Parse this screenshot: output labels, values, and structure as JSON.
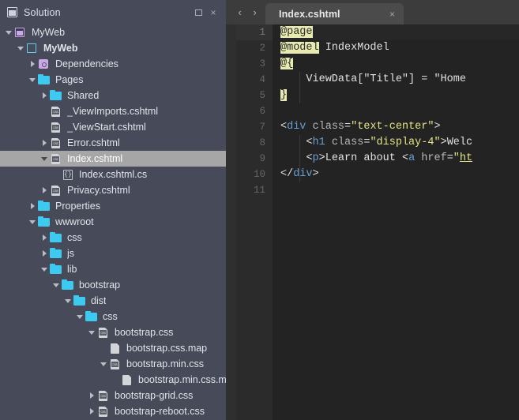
{
  "sidebar": {
    "header": {
      "title": "Solution",
      "icon": "solution-icon",
      "dock_label": "",
      "close_label": "×"
    },
    "tree": [
      {
        "label": "MyWeb",
        "depth": 0,
        "twisty": "open",
        "icon": "solution",
        "bold": false,
        "selected": false
      },
      {
        "label": "MyWeb",
        "depth": 1,
        "twisty": "open",
        "icon": "project",
        "bold": true,
        "selected": false
      },
      {
        "label": "Dependencies",
        "depth": 2,
        "twisty": "closed",
        "icon": "dep",
        "bold": false,
        "selected": false
      },
      {
        "label": "Pages",
        "depth": 2,
        "twisty": "open",
        "icon": "folder",
        "bold": false,
        "selected": false
      },
      {
        "label": "Shared",
        "depth": 3,
        "twisty": "closed",
        "icon": "folder",
        "bold": false,
        "selected": false
      },
      {
        "label": "_ViewImports.cshtml",
        "depth": 3,
        "twisty": "none",
        "icon": "cshtml",
        "bold": false,
        "selected": false
      },
      {
        "label": "_ViewStart.cshtml",
        "depth": 3,
        "twisty": "none",
        "icon": "cshtml",
        "bold": false,
        "selected": false
      },
      {
        "label": "Error.cshtml",
        "depth": 3,
        "twisty": "closed",
        "icon": "cshtml",
        "bold": false,
        "selected": false
      },
      {
        "label": "Index.cshtml",
        "depth": 3,
        "twisty": "open",
        "icon": "cshtml",
        "bold": false,
        "selected": true
      },
      {
        "label": "Index.cshtml.cs",
        "depth": 4,
        "twisty": "none",
        "icon": "cs",
        "bold": false,
        "selected": false
      },
      {
        "label": "Privacy.cshtml",
        "depth": 3,
        "twisty": "closed",
        "icon": "cshtml",
        "bold": false,
        "selected": false
      },
      {
        "label": "Properties",
        "depth": 2,
        "twisty": "closed",
        "icon": "folder",
        "bold": false,
        "selected": false
      },
      {
        "label": "wwwroot",
        "depth": 2,
        "twisty": "open",
        "icon": "folder",
        "bold": false,
        "selected": false
      },
      {
        "label": "css",
        "depth": 3,
        "twisty": "closed",
        "icon": "folder",
        "bold": false,
        "selected": false
      },
      {
        "label": "js",
        "depth": 3,
        "twisty": "closed",
        "icon": "folder",
        "bold": false,
        "selected": false
      },
      {
        "label": "lib",
        "depth": 3,
        "twisty": "open",
        "icon": "folder",
        "bold": false,
        "selected": false
      },
      {
        "label": "bootstrap",
        "depth": 4,
        "twisty": "open",
        "icon": "folder",
        "bold": false,
        "selected": false
      },
      {
        "label": "dist",
        "depth": 5,
        "twisty": "open",
        "icon": "folder",
        "bold": false,
        "selected": false
      },
      {
        "label": "css",
        "depth": 6,
        "twisty": "open",
        "icon": "folder",
        "bold": false,
        "selected": false
      },
      {
        "label": "bootstrap.css",
        "depth": 7,
        "twisty": "open",
        "icon": "cshtml",
        "bold": false,
        "selected": false
      },
      {
        "label": "bootstrap.css.map",
        "depth": 8,
        "twisty": "none",
        "icon": "map",
        "bold": false,
        "selected": false
      },
      {
        "label": "bootstrap.min.css",
        "depth": 8,
        "twisty": "open",
        "icon": "cshtml",
        "bold": false,
        "selected": false
      },
      {
        "label": "bootstrap.min.css.map",
        "depth": 9,
        "twisty": "none",
        "icon": "map",
        "bold": false,
        "selected": false
      },
      {
        "label": "bootstrap-grid.css",
        "depth": 7,
        "twisty": "closed",
        "icon": "cshtml",
        "bold": false,
        "selected": false
      },
      {
        "label": "bootstrap-reboot.css",
        "depth": 7,
        "twisty": "closed",
        "icon": "cshtml",
        "bold": false,
        "selected": false
      }
    ]
  },
  "editor": {
    "nav_back": "‹",
    "nav_forward": "›",
    "tabs": [
      {
        "label": "Index.cshtml",
        "close": "×",
        "active": true
      }
    ],
    "line_numbers": [
      "1",
      "2",
      "3",
      "4",
      "5",
      "6",
      "7",
      "8",
      "9",
      "10",
      "11"
    ],
    "current_line": 1,
    "code_lines": [
      {
        "n": 1,
        "tokens": [
          {
            "t": "@page",
            "c": "razor"
          }
        ]
      },
      {
        "n": 2,
        "tokens": [
          {
            "t": "@model",
            "c": "razor"
          },
          {
            "t": " IndexModel",
            "c": "plain"
          }
        ]
      },
      {
        "n": 3,
        "tokens": [
          {
            "t": "@{",
            "c": "razor"
          }
        ]
      },
      {
        "n": 4,
        "tokens": [
          {
            "t": "    ViewData[",
            "c": "plain"
          },
          {
            "t": "\"Title\"",
            "c": "plain"
          },
          {
            "t": "] = ",
            "c": "plain"
          },
          {
            "t": "\"Home",
            "c": "plain"
          }
        ]
      },
      {
        "n": 5,
        "tokens": [
          {
            "t": "}",
            "c": "razor"
          }
        ]
      },
      {
        "n": 6,
        "tokens": []
      },
      {
        "n": 7,
        "tokens": [
          {
            "t": "<",
            "c": "plain"
          },
          {
            "t": "div",
            "c": "tag"
          },
          {
            "t": " ",
            "c": "plain"
          },
          {
            "t": "class",
            "c": "attr"
          },
          {
            "t": "=",
            "c": "plain"
          },
          {
            "t": "\"text-center\"",
            "c": "str"
          },
          {
            "t": ">",
            "c": "plain"
          }
        ]
      },
      {
        "n": 8,
        "tokens": [
          {
            "t": "    <",
            "c": "plain"
          },
          {
            "t": "h1",
            "c": "tag"
          },
          {
            "t": " ",
            "c": "plain"
          },
          {
            "t": "class",
            "c": "attr"
          },
          {
            "t": "=",
            "c": "plain"
          },
          {
            "t": "\"display-4\"",
            "c": "str"
          },
          {
            "t": ">",
            "c": "plain"
          },
          {
            "t": "Welc",
            "c": "plain"
          }
        ]
      },
      {
        "n": 9,
        "tokens": [
          {
            "t": "    <",
            "c": "plain"
          },
          {
            "t": "p",
            "c": "tag"
          },
          {
            "t": ">",
            "c": "plain"
          },
          {
            "t": "Learn about ",
            "c": "plain"
          },
          {
            "t": "<",
            "c": "plain"
          },
          {
            "t": "a",
            "c": "tag"
          },
          {
            "t": " ",
            "c": "plain"
          },
          {
            "t": "href",
            "c": "attr"
          },
          {
            "t": "=",
            "c": "plain"
          },
          {
            "t": "\"",
            "c": "str"
          },
          {
            "t": "ht",
            "c": "link"
          }
        ]
      },
      {
        "n": 10,
        "tokens": [
          {
            "t": "</",
            "c": "plain"
          },
          {
            "t": "div",
            "c": "tag"
          },
          {
            "t": ">",
            "c": "plain"
          }
        ]
      },
      {
        "n": 11,
        "tokens": []
      }
    ]
  },
  "colors": {
    "sidebar_bg": "#464a59",
    "selection_bg": "#a6a6a6",
    "editor_bg": "#232323",
    "gutter_bg": "#2b2b2b",
    "tabbar_bg": "#3c3c3c",
    "tab_active_bg": "#4b4b4b",
    "folder_cyan": "#3ec9f0",
    "folder_purple": "#c9a8e8",
    "razor_highlight": "#e8ebb0",
    "tag_blue": "#6a9fd4",
    "string_yellow": "#e5e585"
  }
}
